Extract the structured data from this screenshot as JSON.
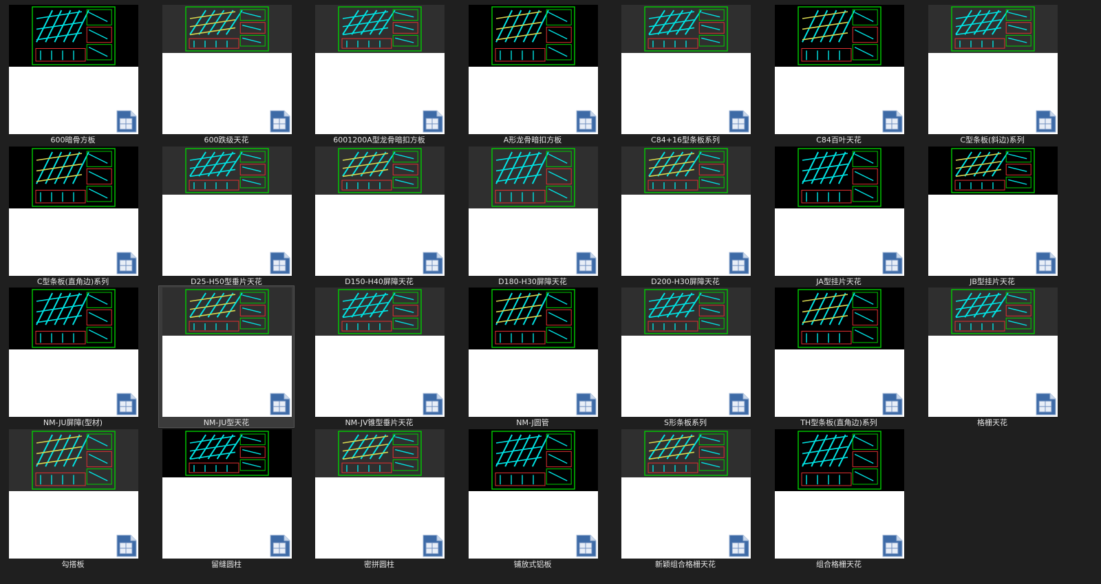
{
  "view": "thumbnail-grid",
  "colors": {
    "background": "#1f1f1f",
    "selected_background": "#3b3b3b",
    "preview_black": "#000000",
    "preview_gray": "#2f2f2f",
    "cad_frame": "#00d000",
    "cad_cyan": "#00e5e5",
    "cad_yellow": "#d8d850",
    "cad_red": "#e03030",
    "label_text": "#e6e6e6"
  },
  "file_icon": "dwg-document-icon",
  "files": [
    {
      "name": "600暗骨方板",
      "preview": "black"
    },
    {
      "name": "600跌级天花",
      "preview": "gray"
    },
    {
      "name": "6001200A型龙骨暗扣方板",
      "preview": "gray"
    },
    {
      "name": "A形龙骨暗扣方板",
      "preview": "black"
    },
    {
      "name": "C84+16型条板系列",
      "preview": "gray"
    },
    {
      "name": "C84百叶天花",
      "preview": "black"
    },
    {
      "name": "C型条板(斜边)系列",
      "preview": "gray"
    },
    {
      "name": "C型条板(直角边)系列",
      "preview": "black"
    },
    {
      "name": "D25-H50型垂片天花",
      "preview": "gray"
    },
    {
      "name": "D150-H40屏障天花",
      "preview": "gray"
    },
    {
      "name": "D180-H30屏障天花",
      "preview": "gray"
    },
    {
      "name": "D200-H30屏障天花",
      "preview": "gray"
    },
    {
      "name": "JA型挂片天花",
      "preview": "black"
    },
    {
      "name": "JB型挂片天花",
      "preview": "black"
    },
    {
      "name": "NM-JU屏障(型材)",
      "preview": "black"
    },
    {
      "name": "NM-JU型天花",
      "preview": "gray",
      "selected": true
    },
    {
      "name": "NM-JV锥型垂片天花",
      "preview": "gray"
    },
    {
      "name": "NM-J圆管",
      "preview": "black"
    },
    {
      "name": "S形条板系列",
      "preview": "gray"
    },
    {
      "name": "TH型条板(直角边)系列",
      "preview": "black"
    },
    {
      "name": "格栅天花",
      "preview": "gray"
    },
    {
      "name": "勾搭板",
      "preview": "gray"
    },
    {
      "name": "留缝圆柱",
      "preview": "black"
    },
    {
      "name": "密拼圆柱",
      "preview": "gray"
    },
    {
      "name": "铺放式铝板",
      "preview": "black"
    },
    {
      "name": "新颖组合格栅天花",
      "preview": "gray"
    },
    {
      "name": "组合格栅天花",
      "preview": "black"
    }
  ]
}
